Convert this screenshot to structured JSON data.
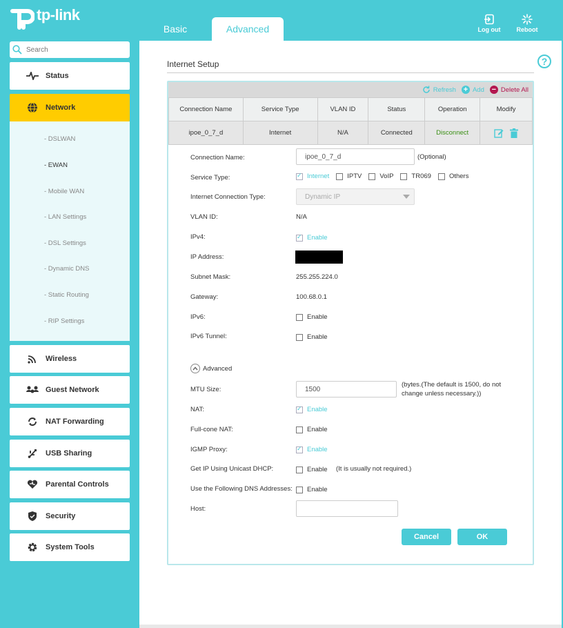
{
  "brand": {
    "name": "tp-link",
    "accent": "#4acbd6",
    "active_nav": "#ffcc00"
  },
  "tabs": [
    {
      "label": "Basic"
    },
    {
      "label": "Advanced"
    }
  ],
  "header_actions": {
    "logout": "Log out",
    "reboot": "Reboot"
  },
  "search": {
    "placeholder": "Search"
  },
  "sidebar": {
    "items": [
      {
        "label": "Status",
        "icon": "pulse-icon"
      },
      {
        "label": "Network",
        "icon": "globe-icon"
      },
      {
        "label": "Wireless",
        "icon": "wifi-icon"
      },
      {
        "label": "Guest Network",
        "icon": "guests-icon"
      },
      {
        "label": "NAT Forwarding",
        "icon": "refresh-arrows-icon"
      },
      {
        "label": "USB Sharing",
        "icon": "usb-icon"
      },
      {
        "label": "Parental Controls",
        "icon": "heart-icon"
      },
      {
        "label": "Security",
        "icon": "shield-icon"
      },
      {
        "label": "System Tools",
        "icon": "gear-icon"
      }
    ],
    "network_sub": [
      "- DSLWAN",
      "- EWAN",
      "- Mobile WAN",
      "- LAN Settings",
      "- DSL Settings",
      "- Dynamic DNS",
      "- Static Routing",
      "- RIP Settings"
    ]
  },
  "page": {
    "title": "Internet Setup",
    "help": "?",
    "toolbar": {
      "refresh": "Refresh",
      "add": "Add",
      "delete_all": "Delete All"
    },
    "table": {
      "headers": [
        "Connection Name",
        "Service Type",
        "VLAN ID",
        "Status",
        "Operation",
        "Modify"
      ],
      "row": {
        "name": "ipoe_0_7_d",
        "service": "Internet",
        "vlan": "N/A",
        "status": "Connected",
        "operation": "Disconnect"
      }
    },
    "form": {
      "connection_name_label": "Connection Name:",
      "connection_name_value": "ipoe_0_7_d",
      "optional": "(Optional)",
      "service_type_label": "Service Type:",
      "service_options": [
        "Internet",
        "IPTV",
        "VoIP",
        "TR069",
        "Others"
      ],
      "ict_label": "Internet Connection Type:",
      "ict_value": "Dynamic IP",
      "vlan_label": "VLAN ID:",
      "vlan_value": "N/A",
      "ipv4_label": "IPv4:",
      "enable": "Enable",
      "ip_label": "IP Address:",
      "subnet_label": "Subnet Mask:",
      "subnet_value": "255.255.224.0",
      "gateway_label": "Gateway:",
      "gateway_value": "100.68.0.1",
      "ipv6_label": "IPv6:",
      "ipv6_tunnel_label": "IPv6 Tunnel:",
      "advanced": "Advanced",
      "mtu_label": "MTU Size:",
      "mtu_value": "1500",
      "mtu_note": "(bytes.(The default is 1500, do not change unless necessary.))",
      "nat_label": "NAT:",
      "fullcone_label": "Full-cone NAT:",
      "igmp_label": "IGMP Proxy:",
      "unicast_label": "Get IP Using Unicast DHCP:",
      "unicast_note": "(It is usually not required.)",
      "dns_label": "Use the Following DNS Addresses:",
      "host_label": "Host:",
      "host_value": "",
      "cancel": "Cancel",
      "ok": "OK"
    }
  }
}
